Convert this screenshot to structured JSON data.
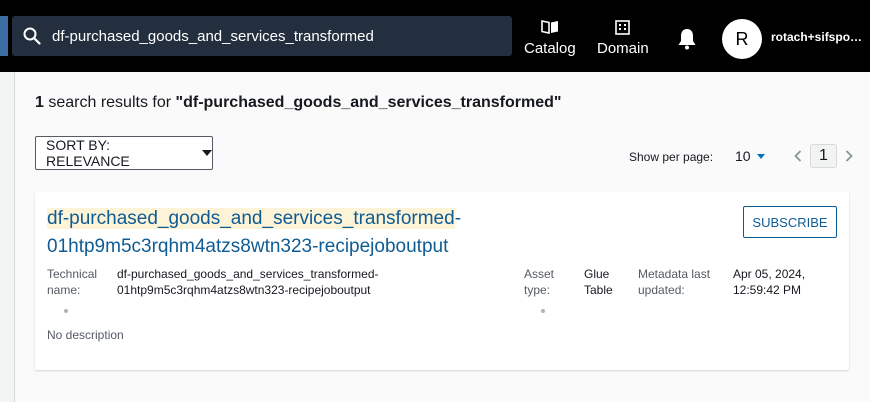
{
  "search": {
    "query": "df-purchased_goods_and_services_transformed"
  },
  "nav": {
    "catalog_label": "Catalog",
    "domain_label": "Domain"
  },
  "user": {
    "initial": "R",
    "name": "rotach+sifspokesman"
  },
  "results": {
    "count": "1",
    "text": " search results for ",
    "query_quoted": "\"df-purchased_goods_and_services_transformed\""
  },
  "sort": {
    "label": "SORT BY: RELEVANCE"
  },
  "pagination": {
    "per_page_label": "Show per page:",
    "per_page_value": "10",
    "current_page": "1"
  },
  "result_card": {
    "title_highlight": "df-purchased_goods_and_services_transformed",
    "title_rest": "-01htp9m5c3rqhm4atzs8wtn323-recipejoboutput",
    "subscribe_label": "SUBSCRIBE",
    "technical_name_label": "Technical name:",
    "technical_name_value": "df-purchased_goods_and_services_transformed-01htp9m5c3rqhm4atzs8wtn323-recipejoboutput",
    "asset_type_label": "Asset type:",
    "asset_type_value": "Glue Table",
    "metadata_updated_label": "Metadata last updated:",
    "metadata_updated_value": "Apr 05, 2024, 12:59:42 PM",
    "description": "No description"
  },
  "colors": {
    "link": "#0f5c94",
    "topbar": "#000000",
    "search_bg": "#232f3e",
    "highlight": "#fdf3d7"
  }
}
